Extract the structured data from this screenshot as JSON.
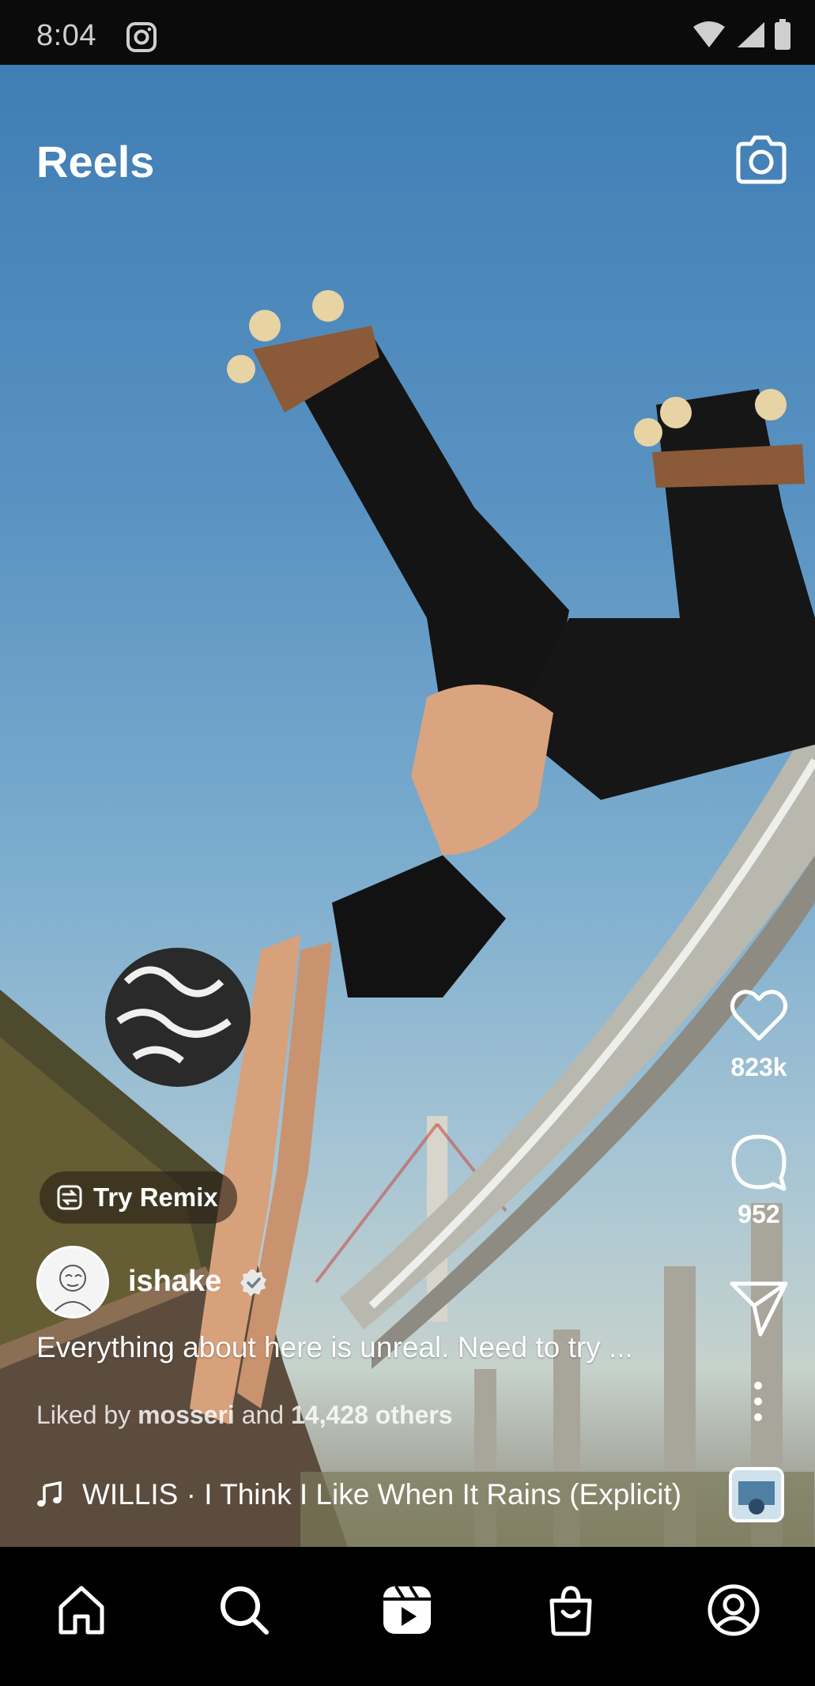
{
  "status_bar": {
    "time": "8:04",
    "app_icon": "instagram-icon",
    "indicators": [
      "wifi-icon",
      "signal-icon",
      "battery-icon"
    ]
  },
  "header": {
    "title": "Reels",
    "camera_icon": "camera-icon"
  },
  "actions": {
    "like_icon": "heart-icon",
    "like_count": "823k",
    "comment_icon": "comment-icon",
    "comment_count": "952",
    "share_icon": "send-icon",
    "more_icon": "more-vertical-icon"
  },
  "remix": {
    "label": "Try Remix",
    "icon": "remix-icon"
  },
  "post": {
    "username": "ishake",
    "verified": true,
    "caption": "Everything about here is unreal. Need to try ...",
    "liked_prefix": "Liked by ",
    "liked_user": "mosseri",
    "liked_middle": " and ",
    "liked_count": "14,428 others"
  },
  "audio": {
    "icon": "music-note-icon",
    "track": "WILLIS · I Think I Like When It Rains (Explicit)"
  },
  "nav": {
    "items": [
      {
        "name": "home",
        "icon": "home-icon"
      },
      {
        "name": "search",
        "icon": "search-icon"
      },
      {
        "name": "reels",
        "icon": "reels-icon"
      },
      {
        "name": "shop",
        "icon": "shop-icon"
      },
      {
        "name": "profile",
        "icon": "profile-icon"
      }
    ]
  },
  "colors": {
    "sky_top": "#3f7db4",
    "sky_bottom": "#a9c6d4",
    "nav_background": "#000000",
    "overlay_text": "#ffffff"
  }
}
